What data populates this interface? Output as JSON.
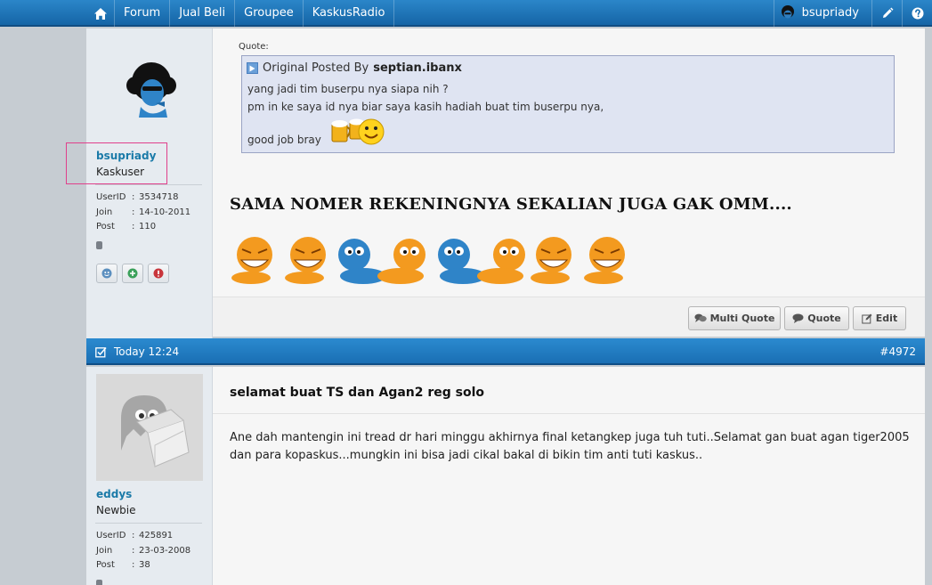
{
  "nav": {
    "items": [
      "Forum",
      "Jual Beli",
      "Groupee",
      "KaskusRadio"
    ],
    "username": "bsupriady"
  },
  "post1": {
    "author": {
      "name": "bsupriady",
      "title": "Kaskuser",
      "userid": "3534718",
      "join": "14-10-2011",
      "post": "110"
    },
    "stat_labels": {
      "userid": "UserID",
      "join": "Join",
      "post": "Post"
    },
    "quote": {
      "caption": "Quote:",
      "prefix": "Original Posted By",
      "author": "septian.ibanx",
      "lines": [
        "yang jadi tim buserpu nya siapa nih ?",
        "pm in ke saya id nya biar saya kasih hadiah buat tim buserpu nya,",
        "good job bray"
      ]
    },
    "heading": "SAMA NOMER REKENINGNYA SEKALIAN JUGA GAK OMM....",
    "buttons": {
      "multi_quote": "Multi Quote",
      "quote": "Quote",
      "edit": "Edit"
    }
  },
  "post2": {
    "date": "Today 12:24",
    "number": "#4972",
    "author": {
      "name": "eddys",
      "title": "Newbie",
      "userid": "425891",
      "join": "23-03-2008",
      "post": "38"
    },
    "title": "selamat buat TS dan Agan2 reg solo",
    "body": "Ane dah mantengin ini tread dr hari minggu akhirnya final ketangkep juga tuh tuti..Selamat gan buat agan tiger2005 dan para kopaskus...mungkin ini bisa jadi cikal bakal di bikin tim anti tuti kaskus.."
  },
  "colors": {
    "nav_blue": "#1e78bd",
    "link": "#1a7aa8",
    "highlight": "#e0408b"
  }
}
